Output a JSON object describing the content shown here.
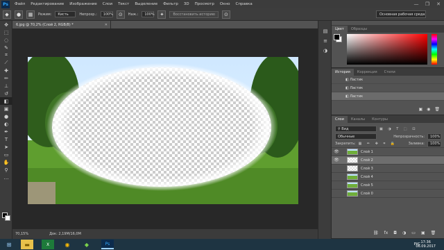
{
  "app": {
    "logo": "Ps"
  },
  "menu": [
    "Файл",
    "Редактирование",
    "Изображение",
    "Слои",
    "Текст",
    "Выделение",
    "Фильтр",
    "3D",
    "Просмотр",
    "Окно",
    "Справка"
  ],
  "window_controls": [
    "—",
    "❐",
    "✕"
  ],
  "options": {
    "mode_label": "Режим:",
    "mode_value": "Кисть",
    "opacity_label": "Непрозр.:",
    "opacity_value": "100%",
    "flow_label": "Наж.:",
    "flow_value": "100%",
    "restore_btn": "Восстановить историю",
    "workspace": "Основная рабочая среда"
  },
  "document": {
    "tab_title": "6.jpg @ 70,2% (Слой 2, RGB/8) *"
  },
  "status": {
    "zoom": "70,15%",
    "doc_size": "Док: 2,19M/16,0M"
  },
  "panels": {
    "color": {
      "tabs": [
        "Цвет",
        "Образцы"
      ]
    },
    "history": {
      "tabs": [
        "История",
        "Коррекция",
        "Стили"
      ],
      "items": [
        "Ластик",
        "Ластик",
        "Ластик"
      ]
    },
    "layers": {
      "tabs": [
        "Слои",
        "Каналы",
        "Контуры"
      ],
      "filter_kind": "Вид",
      "blend_mode": "Обычные",
      "opacity_label": "Непрозрачность:",
      "opacity_value": "100%",
      "lock_label": "Закрепить:",
      "fill_label": "Заливка:",
      "fill_value": "100%",
      "items": [
        {
          "name": "Слой 1",
          "visible": true
        },
        {
          "name": "Слой 2",
          "visible": true
        },
        {
          "name": "Слой 3",
          "visible": false
        },
        {
          "name": "Слой 4",
          "visible": false
        },
        {
          "name": "Слой 5",
          "visible": false
        },
        {
          "name": "Слой 0",
          "visible": false
        }
      ]
    }
  },
  "taskbar": {
    "lang": "РУС",
    "time": "17:36",
    "date": "06.09.2017"
  },
  "colors": {
    "accent": "#31a8ff",
    "panel_bg": "#535353",
    "dark": "#282828"
  }
}
